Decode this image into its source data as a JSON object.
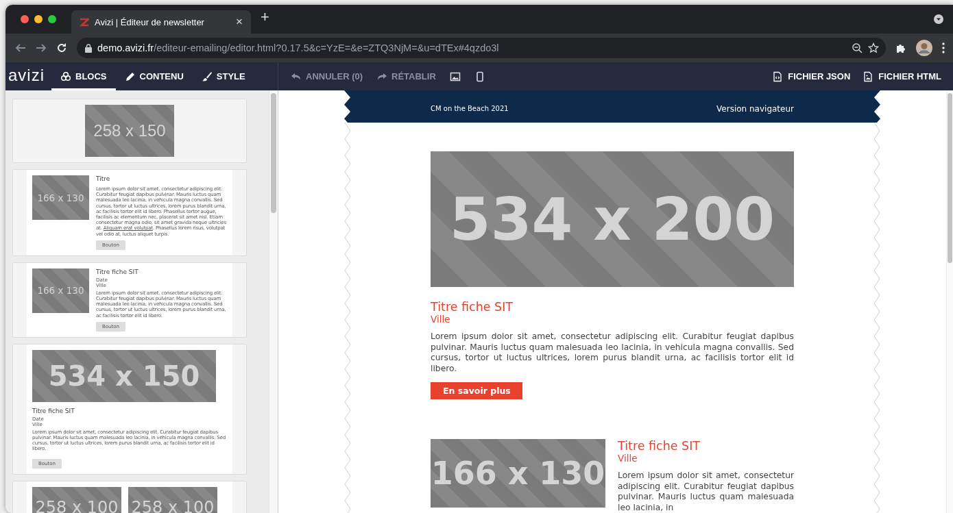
{
  "browser": {
    "tab": {
      "title": "Avizi | Éditeur de newsletter",
      "close": "×"
    },
    "new_tab": "+",
    "url": {
      "host": "demo.avizi.fr",
      "path": "/editeur-emailing/editor.html?0.17.5&c=YzE=&e=ZTQ3NjM=&u=dTEx#4qzdo3l"
    }
  },
  "toolbar": {
    "logo": "avizi",
    "tabs": [
      {
        "label": "BLOCS",
        "kind": "blocks",
        "selected": true
      },
      {
        "label": "CONTENU",
        "kind": "pencil",
        "selected": false
      },
      {
        "label": "STYLE",
        "kind": "brush",
        "selected": false
      }
    ],
    "actions": [
      {
        "label": "ANNULER (0)",
        "kind": "undo",
        "disabled": true
      },
      {
        "label": "RÉTABLIR",
        "kind": "redo",
        "disabled": true
      },
      {
        "kind": "image",
        "disabled": false
      },
      {
        "kind": "mobile",
        "disabled": false
      }
    ],
    "exports": [
      {
        "label": "FICHIER JSON",
        "kind": "json"
      },
      {
        "label": "FICHIER HTML",
        "kind": "html"
      }
    ]
  },
  "blocks": [
    {
      "kind": "image",
      "placeholder": "258 x 150"
    },
    {
      "kind": "image-text",
      "placeholder": "166 x 130",
      "title": "Titre",
      "text": "Lorem ipsum dolor sit amet, consectetur adipiscing elit. Curabitur feugiat dapibus pulvinar. Mauris luctus quam malesuada leo lacinia, in vehicula magna convallis. Sed cursus, tortor ut luctus ultrices, lorem purus blandit urna, ac facilisis tortor elit id libero. Phasellus tortor augue, facilisis ac elementum nec, placerat sit amet nisl. Etiam consectetur magna odio, sit amet gravida neque ultricies at.",
      "link": "Aliquam erat volutpat",
      "text_after": ". Phasellus lorem risus, volutpat vel odio at, luctus aliquet turpis.",
      "button": "Bouton"
    },
    {
      "kind": "sit",
      "placeholder": "166 x 130",
      "title": "Titre fiche SIT",
      "date": "Date",
      "city": "Ville",
      "text": "Lorem ipsum dolor sit amet, consectetur adipiscing elit. Curabitur feugiat dapibus pulvinar. Mauris luctus quam malesuada leo lacinia, in vehicula magna convallis. Sed cursus, tortor ut luctus ultrices, lorem purus blandit urna, ac facilisis tortor elit id libero.",
      "button": "Bouton"
    },
    {
      "kind": "sit-wide",
      "placeholder": "534 x 150",
      "title": "Titre fiche SIT",
      "date": "Date",
      "city": "Ville",
      "text": "Lorem ipsum dolor sit amet, consectetur adipiscing elit. Curabitur feugiat dapibus pulvinar. Mauris luctus quam malesuada leo lacinia, in vehicula magna convallis. Sed cursus, tortor ut luctus ultrices, lorem purus blandit urna, ac facilisis tortor elit id libero.",
      "button": "Bouton"
    },
    {
      "kind": "two-images",
      "placeholders": [
        "258 x 100",
        "258 x 100"
      ]
    }
  ],
  "email": {
    "header": {
      "left": "CM on the Beach 2021",
      "right": "Version navigateur"
    },
    "items": [
      {
        "kind": "wide",
        "placeholder": "534 x 200",
        "title": "Titre fiche SIT",
        "city": "Ville",
        "text": "Lorem ipsum dolor sit amet, consectetur adipiscing elit. Curabitur feugiat dapibus pulvinar. Mauris luctus quam malesuada leo lacinia, in vehicula magna convallis. Sed cursus, tortor ut luctus ultrices, lorem purus blandit urna, ac facilisis tortor elit id libero.",
        "button": "En savoir plus"
      },
      {
        "kind": "side",
        "placeholder": "166 x 130",
        "title": "Titre fiche SIT",
        "city": "Ville",
        "text": "Lorem ipsum dolor sit amet, consectetur adipiscing elit. Curabitur feugiat dapibus pulvinar. Mauris luctus quam malesuada leo lacinia, in"
      }
    ]
  }
}
